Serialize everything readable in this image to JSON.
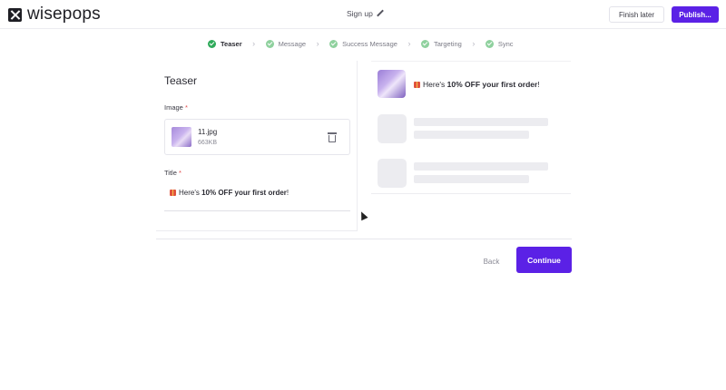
{
  "header": {
    "brand": "wisepops",
    "campaign_name": "Sign up",
    "finish_later_label": "Finish later",
    "publish_label": "Publish..."
  },
  "steps": [
    {
      "label": "Teaser",
      "state": "active"
    },
    {
      "label": "Message",
      "state": "done"
    },
    {
      "label": "Success Message",
      "state": "done"
    },
    {
      "label": "Targeting",
      "state": "done"
    },
    {
      "label": "Sync",
      "state": "done"
    }
  ],
  "form": {
    "title": "Teaser",
    "image_label": "Image",
    "required_mark": "*",
    "image_file": {
      "name": "11.jpg",
      "size": "663KB"
    },
    "title_label": "Title",
    "title_value": {
      "prefix": "Here's ",
      "bold": "10% OFF your first order",
      "suffix": "!"
    }
  },
  "preview": {
    "text": {
      "prefix": "Here's ",
      "bold": "10% OFF your first order",
      "suffix": "!"
    }
  },
  "footer": {
    "back_label": "Back",
    "continue_label": "Continue"
  },
  "colors": {
    "accent": "#5b21e6",
    "step_done": "#8fd19e",
    "step_active": "#2faa5a",
    "required": "#e24a4a"
  }
}
